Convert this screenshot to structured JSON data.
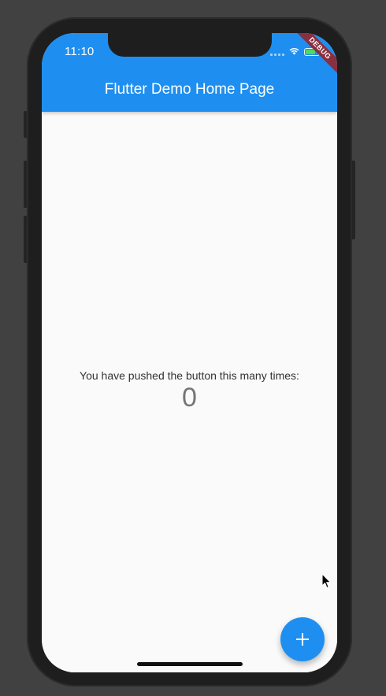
{
  "status_bar": {
    "time": "11:10",
    "icons": [
      "signal-icon",
      "wifi-icon",
      "battery-icon"
    ]
  },
  "debug_banner": {
    "label": "DEBUG",
    "color": "#8a2f3f"
  },
  "app_bar": {
    "title": "Flutter Demo Home Page",
    "color": "#1e8ff0"
  },
  "body": {
    "caption": "You have pushed the button this many times:",
    "counter": "0"
  },
  "fab": {
    "icon": "add-icon",
    "color": "#1e8ff0"
  },
  "colors": {
    "background": "#414141",
    "device_frame": "#1e1e1e",
    "screen_background": "#fafafa"
  }
}
